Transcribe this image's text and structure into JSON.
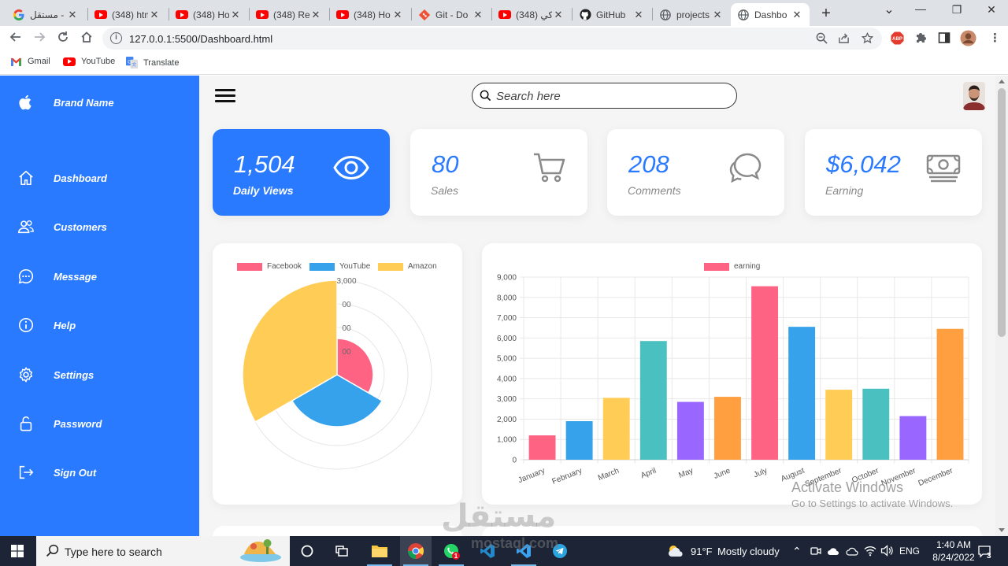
{
  "browser": {
    "tabs": [
      {
        "title": "مستقل -",
        "icon": "google-icon"
      },
      {
        "title": "(348) htm",
        "icon": "youtube-icon"
      },
      {
        "title": "(348) Ho",
        "icon": "youtube-icon"
      },
      {
        "title": "(348) Re",
        "icon": "youtube-icon"
      },
      {
        "title": "(348) Ho",
        "icon": "youtube-icon"
      },
      {
        "title": "Git - Do",
        "icon": "git-icon"
      },
      {
        "title": "(348) كي",
        "icon": "youtube-icon"
      },
      {
        "title": "GitHub",
        "icon": "github-icon"
      },
      {
        "title": "projects",
        "icon": "globe-icon"
      },
      {
        "title": "Dashbo",
        "icon": "globe-icon"
      }
    ],
    "close_glyph": "✕",
    "new_tab_glyph": "+",
    "window_controls": {
      "minimize": "—",
      "restore": "❐",
      "close": "✕",
      "list": "⌄"
    },
    "url": "127.0.0.1:5500/Dashboard.html",
    "bookmarks": [
      {
        "label": "Gmail",
        "icon": "gmail-icon"
      },
      {
        "label": "YouTube",
        "icon": "youtube-icon"
      },
      {
        "label": "Translate",
        "icon": "translate-icon"
      }
    ],
    "abp_badge": "ABP"
  },
  "sidebar": {
    "brand": "Brand Name",
    "items": [
      {
        "label": "Dashboard",
        "icon": "home-icon"
      },
      {
        "label": "Customers",
        "icon": "people-icon"
      },
      {
        "label": "Message",
        "icon": "chat-icon"
      },
      {
        "label": "Help",
        "icon": "info-icon"
      },
      {
        "label": "Settings",
        "icon": "gear-icon"
      },
      {
        "label": "Password",
        "icon": "lock-icon"
      },
      {
        "label": "Sign Out",
        "icon": "logout-icon"
      }
    ]
  },
  "topbar": {
    "search_placeholder": "Search here"
  },
  "cards": [
    {
      "value": "1,504",
      "label": "Daily Views",
      "icon": "eye-icon",
      "active": true
    },
    {
      "value": "80",
      "label": "Sales",
      "icon": "cart-icon",
      "active": false
    },
    {
      "value": "208",
      "label": "Comments",
      "icon": "comments-icon",
      "active": false
    },
    {
      "value": "$6,042",
      "label": "Earning",
      "icon": "cash-icon",
      "active": false
    }
  ],
  "colors": {
    "accent": "#2a7aff",
    "pink": "#ff6384",
    "blue": "#36a2eb",
    "yellow": "#ffcd56",
    "teal": "#4bc0c0",
    "purple": "#9966ff",
    "orange": "#ff9f40"
  },
  "chart_data": [
    {
      "type": "polarArea",
      "legend_position": "top",
      "categories": [
        "Facebook",
        "YouTube",
        "Amazon"
      ],
      "values": [
        1150,
        1650,
        3000
      ],
      "colors": [
        "#ff6384",
        "#36a2eb",
        "#ffcd56"
      ],
      "r_ticks_visible": [
        "3,000",
        "00",
        "00",
        "00"
      ]
    },
    {
      "type": "bar",
      "legend_position": "top",
      "series": [
        {
          "name": "earning",
          "values": [
            1200,
            1900,
            3050,
            5850,
            2850,
            3100,
            8550,
            6550,
            3450,
            3500,
            2150,
            6450
          ]
        }
      ],
      "categories": [
        "January",
        "February",
        "March",
        "April",
        "May",
        "June",
        "July",
        "August",
        "September",
        "October",
        "November",
        "December"
      ],
      "bar_colors": [
        "#ff6384",
        "#36a2eb",
        "#ffcd56",
        "#4bc0c0",
        "#9966ff",
        "#ff9f40",
        "#ff6384",
        "#36a2eb",
        "#ffcd56",
        "#4bc0c0",
        "#9966ff",
        "#ff9f40"
      ],
      "legend_color": "#ff6384",
      "ylim": [
        0,
        9000
      ],
      "yticks": [
        "0",
        "1,000",
        "2,000",
        "3,000",
        "4,000",
        "5,000",
        "6,000",
        "7,000",
        "8,000",
        "9,000"
      ],
      "grid": true
    }
  ],
  "watermark": {
    "activate_title": "Activate Windows",
    "activate_sub": "Go to Settings to activate Windows.",
    "site_ar": "مستقل",
    "site_en": "mostaql.com"
  },
  "taskbar": {
    "search_text": "Type here to search",
    "temperature": "91°F",
    "weather": "Mostly cloudy",
    "lang": "ENG",
    "time": "1:40 AM",
    "date": "8/24/2022",
    "whatsapp_badge": "1",
    "notification_count": "3"
  }
}
